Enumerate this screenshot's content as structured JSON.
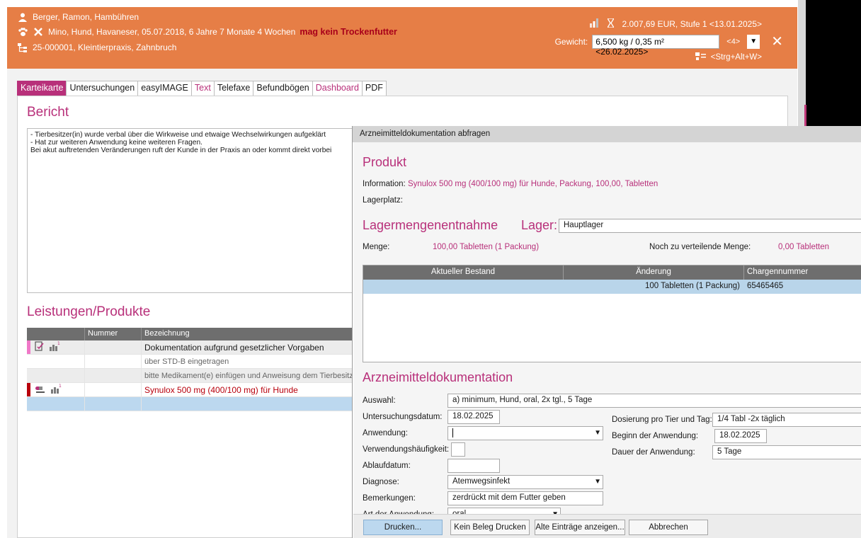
{
  "header": {
    "owner": "Berger, Ramon, Hambühren",
    "animal": "Mino, Hund, Havaneser, 05.07.2018, 6 Jahre 7 Monate 4 Wochen",
    "animal_warning": "mag kein Trockenfutter",
    "practice": "25-000001, Kleintierpraxis, Zahnbruch",
    "balance": "2.007,69 EUR, Stufe 1 <13.01.2025>",
    "weight_label": "Gewicht:",
    "weight_value": "6,500 kg / 0,35 m² <26.02.2025>",
    "weight_badge": "<4>",
    "shortcut": "<Strg+Alt+W>",
    "accent_color": "#e67e46"
  },
  "tabs": [
    {
      "label": "Karteikarte",
      "active": true
    },
    {
      "label": "Untersuchungen"
    },
    {
      "label": "easyIMAGE"
    },
    {
      "label": "Text",
      "pink": true
    },
    {
      "label": "Telefaxe"
    },
    {
      "label": "Befundbögen"
    },
    {
      "label": "Dashboard",
      "pink": true
    },
    {
      "label": "PDF"
    }
  ],
  "bericht": {
    "title": "Bericht",
    "text": "- Tierbesitzer(in) wurde verbal über die Wirkweise und etwaige Wechselwirkungen aufgeklärt\n- Hat zur weiteren Anwendung keine weiteren Fragen.\nBei akut auftretenden Veränderungen ruft der Kunde in der Praxis an oder kommt direkt vorbei"
  },
  "leistungen": {
    "title": "Leistungen/Produkte",
    "columns": [
      "Nummer",
      "Bezeichnung"
    ],
    "rows": [
      {
        "text": "Dokumentation aufgrund gesetzlicher Vorgaben"
      },
      {
        "text": "über STD-B eingetragen"
      },
      {
        "text": "bitte Medikament(e) einfügen und Anweisung dem Tierbesitzer"
      },
      {
        "text": "Synulox 500 mg (400/100 mg) für Hunde"
      }
    ]
  },
  "dialog": {
    "title": "Arzneimitteldokumentation abfragen",
    "produkt_title": "Produkt",
    "info_label": "Information:",
    "info_value": "Synulox 500 mg (400/100 mg) für Hunde, Packung, 100,00, Tabletten",
    "lagerplatz_label": "Lagerplatz:",
    "lager_title": "Lagermengenentnahme",
    "lager_label": "Lager:",
    "lager_value": "Hauptlager",
    "menge_label": "Menge:",
    "menge_value": "100,00 Tabletten (1 Packung)",
    "noch_label": "Noch zu verteilende Menge:",
    "noch_value": "0,00 Tabletten",
    "stock_columns": [
      "Aktueller Bestand",
      "Änderung",
      "Chargennummer"
    ],
    "stock_row": {
      "bestand": "",
      "aenderung": "100  Tabletten (1 Packung)",
      "charge": "65465465"
    },
    "doku_title": "Arzneimitteldokumentation",
    "auswahl_label": "Auswahl:",
    "auswahl_value": "a) minimum, Hund, oral, 2x tgl., 5 Tage",
    "udatum_label": "Untersuchungsdatum:",
    "udatum_value": "18.02.2025",
    "anwendung_label": "Anwendung:",
    "anwendung_value": "",
    "vhaeufigkeit_label": "Verwendungshäufigkeit:",
    "vhaeufigkeit_value": "",
    "ablauf_label": "Ablaufdatum:",
    "ablauf_value": "",
    "diagnose_label": "Diagnose:",
    "diagnose_value": "Atemwegsinfekt",
    "bemerk_label": "Bemerkungen:",
    "bemerk_value": "zerdrückt mit dem Futter geben",
    "art_label": "Art der Anwendung:",
    "art_value": "oral",
    "dosierung_label": "Dosierung pro Tier und Tag:",
    "dosierung_value": "1/4 Tabl -2x täglich",
    "beginn_label": "Beginn der Anwendung:",
    "beginn_value": "18.02.2025",
    "dauer_label": "Dauer der Anwendung:",
    "dauer_value": "5 Tage",
    "buttons": {
      "drucken": "Drucken...",
      "kein_beleg": "Kein Beleg Drucken",
      "alte": "Alte Einträge anzeigen...",
      "abbrechen": "Abbrechen"
    }
  }
}
